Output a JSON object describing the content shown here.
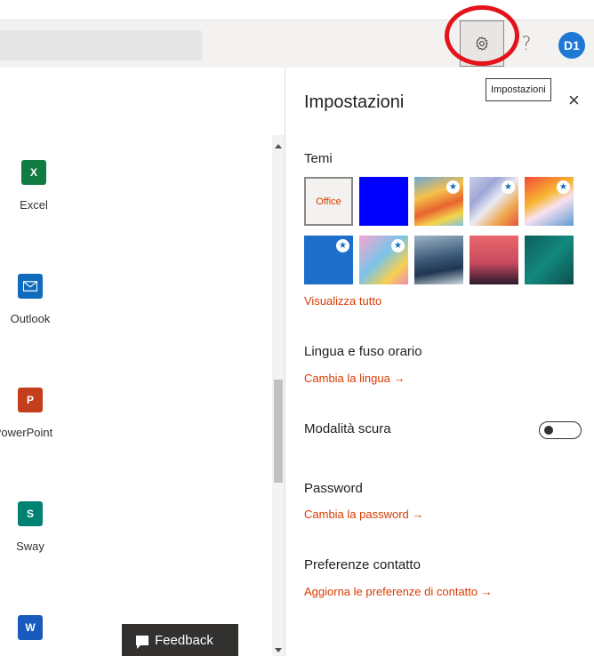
{
  "topbar": {
    "help_label": "?",
    "avatar_initials": "D1",
    "settings_tooltip": "Impostazioni"
  },
  "apps": [
    {
      "label": "Excel",
      "letter": "X",
      "color": "#107c41"
    },
    {
      "label": "Outlook",
      "letter": "",
      "color": "#0f6cbd"
    },
    {
      "label": "PowerPoint",
      "letter": "P",
      "color": "#c43e1c"
    },
    {
      "label": "Sway",
      "letter": "S",
      "color": "#008272"
    },
    {
      "label": "",
      "letter": "W",
      "color": "#185abd"
    }
  ],
  "feedback_label": "Feedback",
  "settings_panel": {
    "title": "Impostazioni",
    "close_label": "×",
    "themes": {
      "title": "Temi",
      "office_label": "Office",
      "view_all": "Visualizza tutto"
    },
    "language": {
      "title": "Lingua e fuso orario",
      "link": "Cambia la lingua →"
    },
    "dark_mode": {
      "title": "Modalità scura",
      "enabled": false
    },
    "password": {
      "title": "Password",
      "link": "Cambia la password →"
    },
    "contact": {
      "title": "Preferenze contatto",
      "link": "Aggiorna le preferenze di contatto →"
    }
  },
  "colors": {
    "accent_link": "#d83b01",
    "avatar": "#1e78d4",
    "highlight": "#e3121b"
  }
}
